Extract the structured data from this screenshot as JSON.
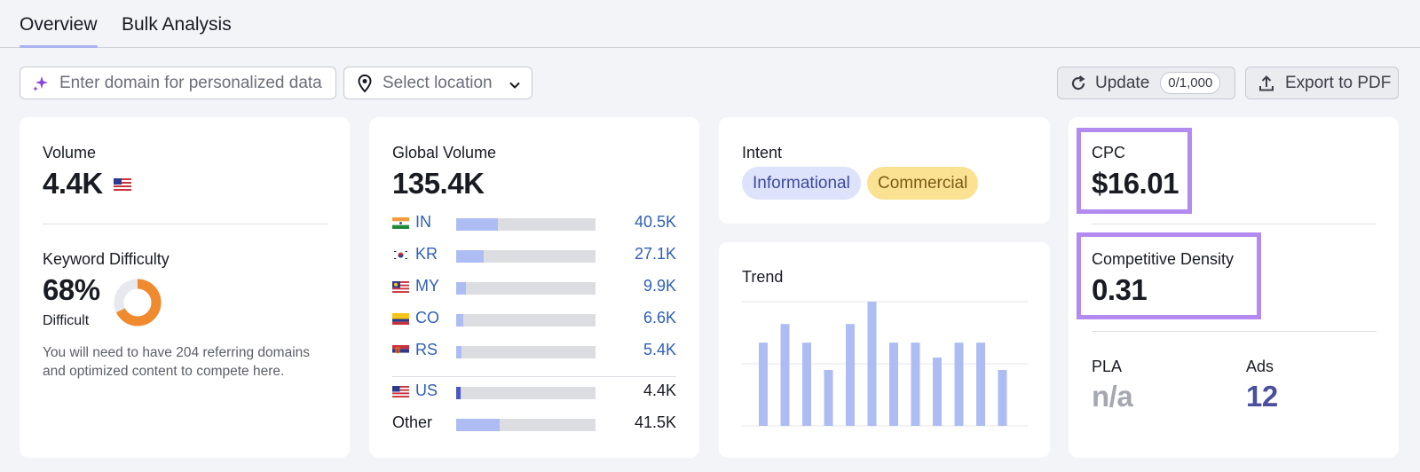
{
  "tabs": [
    {
      "label": "Overview",
      "active": true
    },
    {
      "label": "Bulk Analysis",
      "active": false
    }
  ],
  "toolbar": {
    "domain_placeholder": "Enter domain for personalized data",
    "location_placeholder": "Select location",
    "update_label": "Update",
    "update_counter": "0/1,000",
    "export_label": "Export to PDF"
  },
  "volume": {
    "label": "Volume",
    "value": "4.4K",
    "flag": "US"
  },
  "difficulty": {
    "label": "Keyword Difficulty",
    "value": "68%",
    "percent": 68,
    "level": "Difficult",
    "description": "You will need to have 204 referring domains and optimized content to compete here."
  },
  "global_volume": {
    "label": "Global Volume",
    "value": "135.4K",
    "countries": [
      {
        "code": "IN",
        "value": "40.5K",
        "fraction": 0.3
      },
      {
        "code": "KR",
        "value": "27.1K",
        "fraction": 0.2
      },
      {
        "code": "MY",
        "value": "9.9K",
        "fraction": 0.07
      },
      {
        "code": "CO",
        "value": "6.6K",
        "fraction": 0.05
      },
      {
        "code": "RS",
        "value": "5.4K",
        "fraction": 0.04
      }
    ],
    "us": {
      "code": "US",
      "value": "4.4K",
      "fraction": 0.03
    },
    "other": {
      "label": "Other",
      "value": "41.5K",
      "fraction": 0.31
    }
  },
  "intent": {
    "label": "Intent",
    "tags": [
      "Informational",
      "Commercial"
    ]
  },
  "trend": {
    "label": "Trend",
    "values": [
      0.67,
      0.82,
      0.67,
      0.45,
      0.82,
      1.0,
      0.67,
      0.67,
      0.55,
      0.67,
      0.67,
      0.45
    ]
  },
  "cpc": {
    "label": "CPC",
    "value": "$16.01"
  },
  "competitive_density": {
    "label": "Competitive Density",
    "value": "0.31"
  },
  "pla": {
    "label": "PLA",
    "value": "n/a"
  },
  "ads": {
    "label": "Ads",
    "value": "12"
  },
  "colors": {
    "accent_bar": "#aebcf4",
    "highlight": "#b38af0",
    "difficulty_orange": "#f08a2e",
    "link_blue": "#2f5fb3",
    "ads_purple": "#4a4f9e"
  }
}
